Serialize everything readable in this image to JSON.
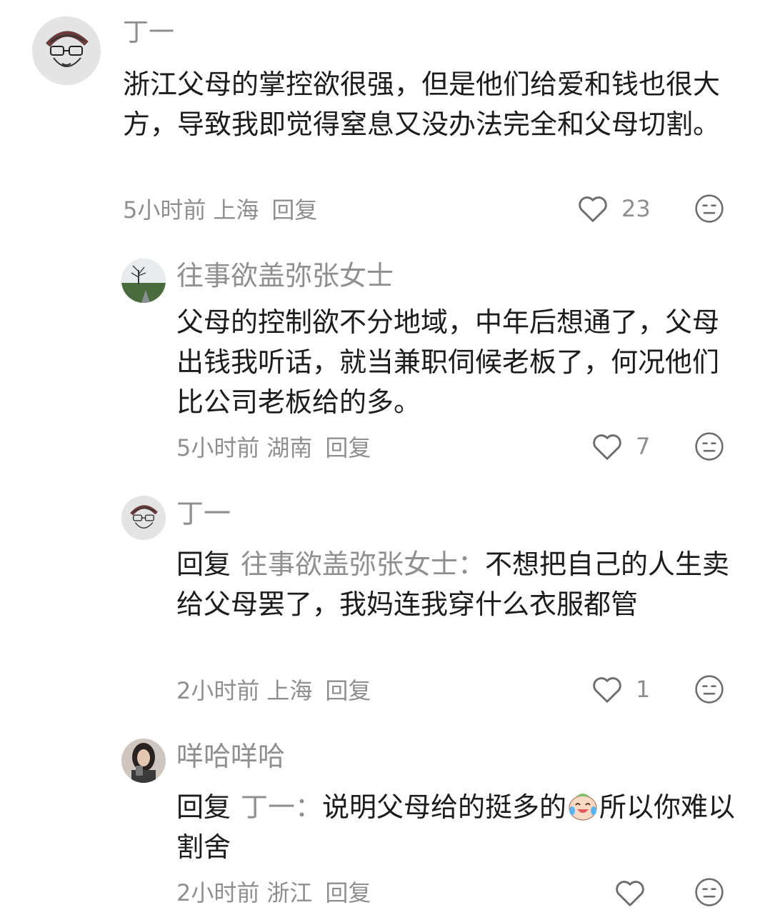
{
  "comments": [
    {
      "author": "丁一",
      "text": "浙江父母的掌控欲很强，但是他们给爱和钱也很大方，导致我即觉得窒息又没办法完全和父母切割。",
      "time": "5小时前",
      "location": "上海",
      "reply_label": "回复",
      "likes": "23",
      "avatar_icon": "sketch-glasses-avatar"
    },
    {
      "author": "往事欲盖弥张女士",
      "text": "父母的控制欲不分地域，中年后想通了，父母出钱我听话，就当兼职伺候老板了，何况他们比公司老板给的多。",
      "time": "5小时前",
      "location": "湖南",
      "reply_label": "回复",
      "likes": "7",
      "avatar_icon": "landscape-tree-avatar"
    },
    {
      "author": "丁一",
      "reply_prefix": "回复",
      "reply_to": "往事欲盖弥张女士：",
      "text": "不想把自己的人生卖给父母罢了，我妈连我穿什么衣服都管",
      "time": "2小时前",
      "location": "上海",
      "reply_label": "回复",
      "likes": "1",
      "avatar_icon": "sketch-glasses-avatar"
    },
    {
      "author": "咩哈咩哈",
      "reply_prefix": "回复",
      "reply_to": "丁一：",
      "text_before": "说明父母给的挺多的",
      "emoji_icon": "crying-laughing-emoji",
      "text_after": "所以你难以割舍",
      "time": "2小时前",
      "location": "浙江",
      "reply_label": "回复",
      "likes": "",
      "avatar_icon": "girl-photo-avatar"
    }
  ],
  "colors": {
    "text": "#1c1c1c",
    "muted": "#8f8f8f",
    "background": "#ffffff"
  }
}
